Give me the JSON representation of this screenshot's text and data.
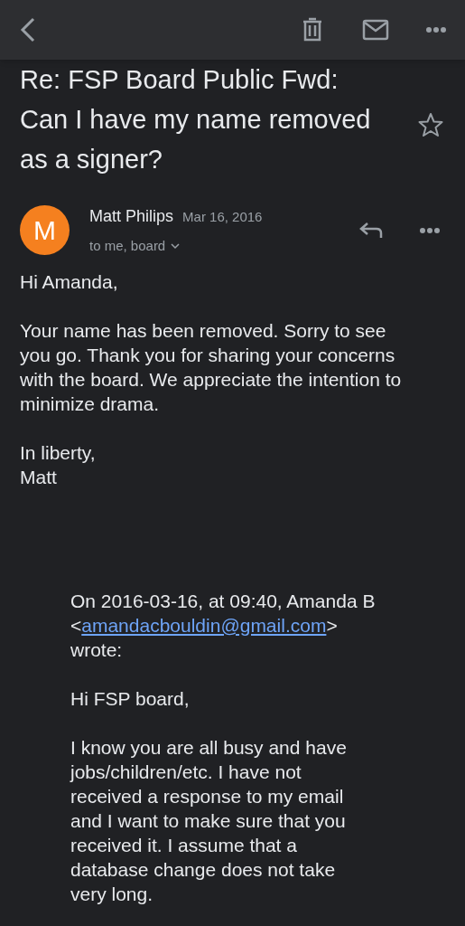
{
  "subject": "Re: FSP Board Public Fwd: Can I have my name removed as a signer?",
  "starred": false,
  "message": {
    "avatar_letter": "M",
    "sender": "Matt Philips",
    "date": "Mar 16, 2016",
    "recipients": "to me, board",
    "paragraphs": [
      [
        "Hi Amanda,"
      ],
      [
        "Your name has been removed. Sorry to see",
        "you go. Thank you for sharing your concerns",
        "with the board. We appreciate the intention to",
        "minimize drama."
      ],
      [
        "In liberty,",
        "Matt"
      ]
    ]
  },
  "quote": {
    "attribution_before": "On 2016-03-16, at 09:40, Amanda B <",
    "email": "amandacbouldin@gmail.com",
    "attribution_after": ">",
    "wrote": "wrote:",
    "paragraphs": [
      [
        "Hi FSP board,"
      ],
      [
        "I know you are all busy and have",
        "jobs/children/etc. I have not",
        "received a response to my email",
        "and I want to make sure that you",
        "received it. I assume that a",
        "database change does not take",
        "very long."
      ]
    ]
  }
}
